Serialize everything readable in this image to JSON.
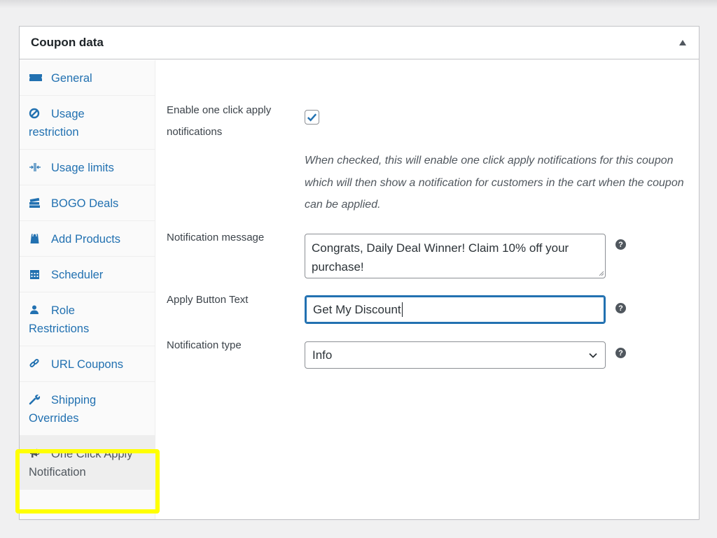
{
  "panel": {
    "title": "Coupon data",
    "toggle_icon": "triangle-up-icon"
  },
  "tabs": [
    {
      "label_line1": "General",
      "label_line2": "",
      "icon": "ticket-icon",
      "active": false
    },
    {
      "label_line1": "Usage",
      "label_line2": "restriction",
      "icon": "no-entry-icon",
      "active": false
    },
    {
      "label_line1": "Usage limits",
      "label_line2": "",
      "icon": "arrows-in-icon",
      "active": false
    },
    {
      "label_line1": "BOGO Deals",
      "label_line2": "",
      "icon": "stacked-tickets-icon",
      "active": false
    },
    {
      "label_line1": "Add Products",
      "label_line2": "",
      "icon": "shopping-bag-icon",
      "active": false
    },
    {
      "label_line1": "Scheduler",
      "label_line2": "",
      "icon": "calendar-icon",
      "active": false
    },
    {
      "label_line1": "Role",
      "label_line2": "Restrictions",
      "icon": "user-icon",
      "active": false
    },
    {
      "label_line1": "URL Coupons",
      "label_line2": "",
      "icon": "link-icon",
      "active": false
    },
    {
      "label_line1": "Shipping",
      "label_line2": "Overrides",
      "icon": "wrench-icon",
      "active": false
    },
    {
      "label_line1": "One Click Apply",
      "label_line2": "Notification",
      "icon": "megaphone-icon",
      "active": true
    }
  ],
  "highlight_color": "#ffff00",
  "accent_color": "#2271b1",
  "form": {
    "enable": {
      "label_line1": "Enable one click apply",
      "label_line2": "notifications",
      "checked": true,
      "description": "When checked, this will enable one click apply notifications for this coupon which will then show a notification for customers in the cart when the coupon can be applied."
    },
    "message": {
      "label": "Notification message",
      "value": "Congrats, Daily Deal Winner! Claim 10% off your purchase!"
    },
    "button_text": {
      "label": "Apply Button Text",
      "value": "Get My Discount"
    },
    "type": {
      "label": "Notification type",
      "selected": "Info"
    },
    "help_glyph": "?"
  }
}
